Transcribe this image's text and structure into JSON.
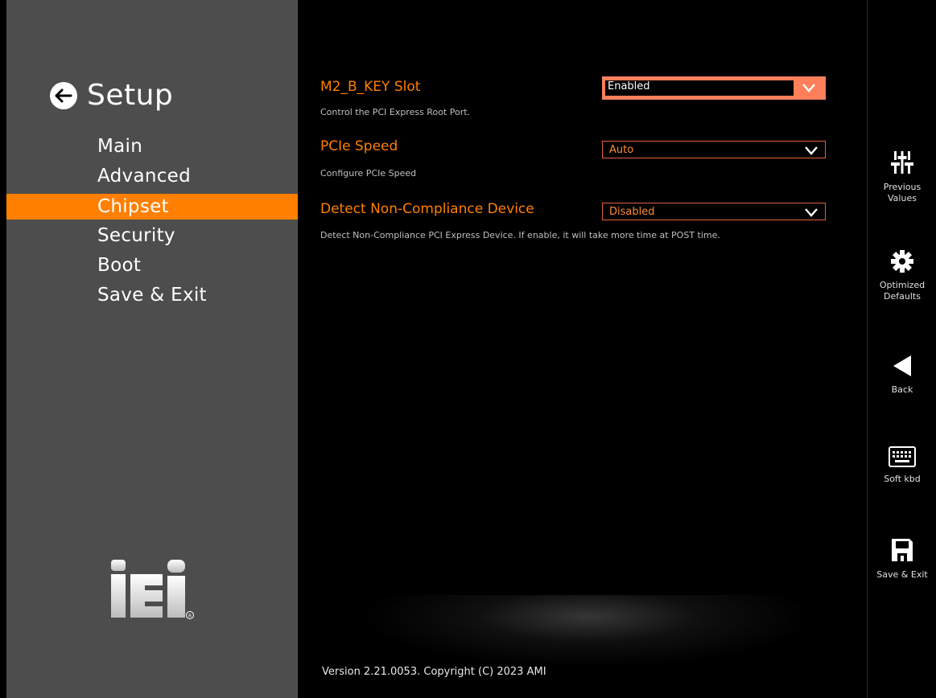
{
  "sidebar": {
    "title": "Setup",
    "menu": [
      "Main",
      "Advanced",
      "Chipset",
      "Security",
      "Boot",
      "Save & Exit"
    ],
    "active_index": 2,
    "logo_text": "iEi",
    "logo_mark": "®"
  },
  "settings": [
    {
      "label": "M2_B_KEY Slot",
      "help": "Control the PCI Express Root Port.",
      "value": "Enabled"
    },
    {
      "label": "PCIe Speed",
      "help": "Configure PCIe Speed",
      "value": "Auto"
    },
    {
      "label": "Detect Non-Compliance Device",
      "help": "Detect Non-Compliance PCI Express Device. If enable, it will take more time at POST time.",
      "value": "Disabled"
    }
  ],
  "footer": {
    "version": "Version 2.21.0053. Copyright (C) 2023 AMI"
  },
  "rightbar": {
    "previous_values": "Previous Values",
    "optimized_defaults": "Optimized Defaults",
    "back": "Back",
    "soft_kbd": "Soft kbd",
    "save_exit": "Save & Exit"
  },
  "colors": {
    "accent": "#ff7f00",
    "sidebar_bg": "#4d4d4d",
    "focus_bg": "#ff7f5a"
  }
}
